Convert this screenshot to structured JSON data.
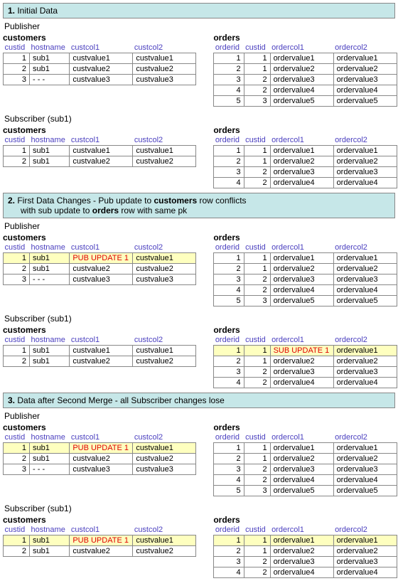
{
  "sections": [
    {
      "num": "1.",
      "title": "Initial Data",
      "sub": ""
    },
    {
      "num": "2.",
      "title": "First Data Changes - Pub update to <b>customers</b> row conflicts",
      "sub": "with sub update to <b>orders</b> row with same pk"
    },
    {
      "num": "3.",
      "title": "Data after Second Merge - all Subscriber changes lose",
      "sub": ""
    }
  ],
  "labels": {
    "publisher": "Publisher",
    "subscriber": "Subscriber (sub1)"
  },
  "tables": {
    "customers": {
      "title": "customers",
      "headers": [
        "custid",
        "hostname",
        "custcol1",
        "custcol2"
      ]
    },
    "orders": {
      "title": "orders",
      "headers": [
        "orderid",
        "custid",
        "ordercol1",
        "ordercol2"
      ]
    }
  },
  "pub_update": "PUB UPDATE 1",
  "sub_update": "SUB UPDATE 1",
  "data": {
    "s1": {
      "pub_cust": [
        [
          "1",
          "sub1",
          "custvalue1",
          "custvalue1"
        ],
        [
          "2",
          "sub1",
          "custvalue2",
          "custvalue2"
        ],
        [
          "3",
          "- - -",
          "custvalue3",
          "custvalue3"
        ]
      ],
      "pub_ord": [
        [
          "1",
          "1",
          "ordervalue1",
          "ordervalue1"
        ],
        [
          "2",
          "1",
          "ordervalue2",
          "ordervalue2"
        ],
        [
          "3",
          "2",
          "ordervalue3",
          "ordervalue3"
        ],
        [
          "4",
          "2",
          "ordervalue4",
          "ordervalue4"
        ],
        [
          "5",
          "3",
          "ordervalue5",
          "ordervalue5"
        ]
      ],
      "sub_cust": [
        [
          "1",
          "sub1",
          "custvalue1",
          "custvalue1"
        ],
        [
          "2",
          "sub1",
          "custvalue2",
          "custvalue2"
        ]
      ],
      "sub_ord": [
        [
          "1",
          "1",
          "ordervalue1",
          "ordervalue1"
        ],
        [
          "2",
          "1",
          "ordervalue2",
          "ordervalue2"
        ],
        [
          "3",
          "2",
          "ordervalue3",
          "ordervalue3"
        ],
        [
          "4",
          "2",
          "ordervalue4",
          "ordervalue4"
        ]
      ]
    },
    "s2": {
      "pub_cust": [
        [
          "1",
          "sub1",
          "PUB UPDATE 1",
          "custvalue1"
        ],
        [
          "2",
          "sub1",
          "custvalue2",
          "custvalue2"
        ],
        [
          "3",
          "- - -",
          "custvalue3",
          "custvalue3"
        ]
      ],
      "pub_cust_hl": [
        0
      ],
      "pub_ord": [
        [
          "1",
          "1",
          "ordervalue1",
          "ordervalue1"
        ],
        [
          "2",
          "1",
          "ordervalue2",
          "ordervalue2"
        ],
        [
          "3",
          "2",
          "ordervalue3",
          "ordervalue3"
        ],
        [
          "4",
          "2",
          "ordervalue4",
          "ordervalue4"
        ],
        [
          "5",
          "3",
          "ordervalue5",
          "ordervalue5"
        ]
      ],
      "sub_cust": [
        [
          "1",
          "sub1",
          "custvalue1",
          "custvalue1"
        ],
        [
          "2",
          "sub1",
          "custvalue2",
          "custvalue2"
        ]
      ],
      "sub_ord": [
        [
          "1",
          "1",
          "SUB UPDATE 1",
          "ordervalue1"
        ],
        [
          "2",
          "1",
          "ordervalue2",
          "ordervalue2"
        ],
        [
          "3",
          "2",
          "ordervalue3",
          "ordervalue3"
        ],
        [
          "4",
          "2",
          "ordervalue4",
          "ordervalue4"
        ]
      ],
      "sub_ord_hl": [
        0
      ]
    },
    "s3": {
      "pub_cust": [
        [
          "1",
          "sub1",
          "PUB UPDATE 1",
          "custvalue1"
        ],
        [
          "2",
          "sub1",
          "custvalue2",
          "custvalue2"
        ],
        [
          "3",
          "- - -",
          "custvalue3",
          "custvalue3"
        ]
      ],
      "pub_cust_hl": [
        0
      ],
      "pub_ord": [
        [
          "1",
          "1",
          "ordervalue1",
          "ordervalue1"
        ],
        [
          "2",
          "1",
          "ordervalue2",
          "ordervalue2"
        ],
        [
          "3",
          "2",
          "ordervalue3",
          "ordervalue3"
        ],
        [
          "4",
          "2",
          "ordervalue4",
          "ordervalue4"
        ],
        [
          "5",
          "3",
          "ordervalue5",
          "ordervalue5"
        ]
      ],
      "sub_cust": [
        [
          "1",
          "sub1",
          "PUB UPDATE 1",
          "custvalue1"
        ],
        [
          "2",
          "sub1",
          "custvalue2",
          "custvalue2"
        ]
      ],
      "sub_cust_hl": [
        0
      ],
      "sub_ord": [
        [
          "1",
          "1",
          "ordervalue1",
          "ordervalue1"
        ],
        [
          "2",
          "1",
          "ordervalue2",
          "ordervalue2"
        ],
        [
          "3",
          "2",
          "ordervalue3",
          "ordervalue3"
        ],
        [
          "4",
          "2",
          "ordervalue4",
          "ordervalue4"
        ]
      ],
      "sub_ord_hl": [
        0
      ]
    }
  }
}
